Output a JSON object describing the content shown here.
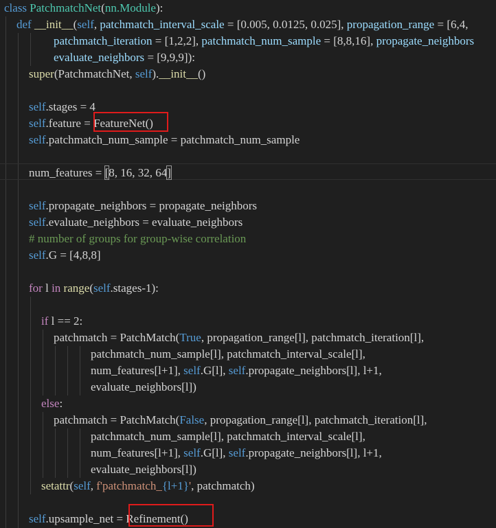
{
  "code_lines": [
    [
      [
        "kw",
        "class "
      ],
      [
        "cls",
        "PatchmatchNet"
      ],
      [
        "plain",
        "("
      ],
      [
        "cls",
        "nn.Module"
      ],
      [
        "plain",
        "):"
      ]
    ],
    [
      [
        "kw",
        "def "
      ],
      [
        "fn",
        "__init__"
      ],
      [
        "plain",
        "("
      ],
      [
        "self",
        "self"
      ],
      [
        "plain",
        ", "
      ],
      [
        "param",
        "patchmatch_interval_scale"
      ],
      [
        "plain",
        " = [0.005, 0.0125, 0.025], "
      ],
      [
        "param",
        "propagation_range"
      ],
      [
        "plain",
        " = [6,4,"
      ]
    ],
    [
      [
        "param",
        "patchmatch_iteration"
      ],
      [
        "plain",
        " = [1,2,2], "
      ],
      [
        "param",
        "patchmatch_num_sample"
      ],
      [
        "plain",
        " = [8,8,16], "
      ],
      [
        "param",
        "propagate_neighbors"
      ]
    ],
    [
      [
        "param",
        "evaluate_neighbors"
      ],
      [
        "plain",
        " = [9,9,9]):"
      ]
    ],
    [
      [
        "fn",
        "super"
      ],
      [
        "plain",
        "(PatchmatchNet, "
      ],
      [
        "self",
        "self"
      ],
      [
        "plain",
        ")."
      ],
      [
        "fn",
        "__init__"
      ],
      [
        "plain",
        "()"
      ]
    ],
    [],
    [
      [
        "self",
        "self"
      ],
      [
        "plain",
        ".stages = 4"
      ]
    ],
    [
      [
        "self",
        "self"
      ],
      [
        "plain",
        ".feature = "
      ],
      [
        "plain",
        "FeatureNet()"
      ]
    ],
    [
      [
        "self",
        "self"
      ],
      [
        "plain",
        ".patchmatch_num_sample = patchmatch_num_sample"
      ]
    ],
    [],
    [
      [
        "plain",
        "num_features = "
      ],
      [
        "plain",
        "[8, 16, 32, 64]"
      ]
    ],
    [],
    [
      [
        "self",
        "self"
      ],
      [
        "plain",
        ".propagate_neighbors = propagate_neighbors"
      ]
    ],
    [
      [
        "self",
        "self"
      ],
      [
        "plain",
        ".evaluate_neighbors = evaluate_neighbors"
      ]
    ],
    [
      [
        "cm",
        "# number of groups for group-wise correlation"
      ]
    ],
    [
      [
        "self",
        "self"
      ],
      [
        "plain",
        ".G = [4,8,8]"
      ]
    ],
    [],
    [
      [
        "ctl",
        "for "
      ],
      [
        "plain",
        "l "
      ],
      [
        "ctl",
        "in "
      ],
      [
        "fn",
        "range"
      ],
      [
        "plain",
        "("
      ],
      [
        "self",
        "self"
      ],
      [
        "plain",
        ".stages-1):"
      ]
    ],
    [],
    [
      [
        "ctl",
        "if "
      ],
      [
        "plain",
        "l == 2:"
      ]
    ],
    [
      [
        "plain",
        "patchmatch = PatchMatch("
      ],
      [
        "kw",
        "True"
      ],
      [
        "plain",
        ", propagation_range[l], patchmatch_iteration[l],"
      ]
    ],
    [
      [
        "plain",
        "patchmatch_num_sample[l], patchmatch_interval_scale[l],"
      ]
    ],
    [
      [
        "plain",
        "num_features[l+1], "
      ],
      [
        "self",
        "self"
      ],
      [
        "plain",
        ".G[l], "
      ],
      [
        "self",
        "self"
      ],
      [
        "plain",
        ".propagate_neighbors[l], l+1,"
      ]
    ],
    [
      [
        "plain",
        "evaluate_neighbors[l])"
      ]
    ],
    [
      [
        "ctl",
        "else"
      ],
      [
        "plain",
        ":"
      ]
    ],
    [
      [
        "plain",
        "patchmatch = PatchMatch("
      ],
      [
        "kw",
        "False"
      ],
      [
        "plain",
        ", propagation_range[l], patchmatch_iteration[l],"
      ]
    ],
    [
      [
        "plain",
        "patchmatch_num_sample[l], patchmatch_interval_scale[l],"
      ]
    ],
    [
      [
        "plain",
        "num_features[l+1], "
      ],
      [
        "self",
        "self"
      ],
      [
        "plain",
        ".G[l], "
      ],
      [
        "self",
        "self"
      ],
      [
        "plain",
        ".propagate_neighbors[l], l+1,"
      ]
    ],
    [
      [
        "plain",
        "evaluate_neighbors[l])"
      ]
    ],
    [
      [
        "fn",
        "setattr"
      ],
      [
        "plain",
        "("
      ],
      [
        "self",
        "self"
      ],
      [
        "plain",
        ", "
      ],
      [
        "str",
        "f'patchmatch_"
      ],
      [
        "kw",
        "{l+1}"
      ],
      [
        "str",
        "'"
      ],
      [
        "plain",
        ", patchmatch)"
      ]
    ],
    [],
    [
      [
        "self",
        "self"
      ],
      [
        "plain",
        ".upsample_net = "
      ],
      [
        "plain",
        "Refinement()"
      ]
    ]
  ]
}
